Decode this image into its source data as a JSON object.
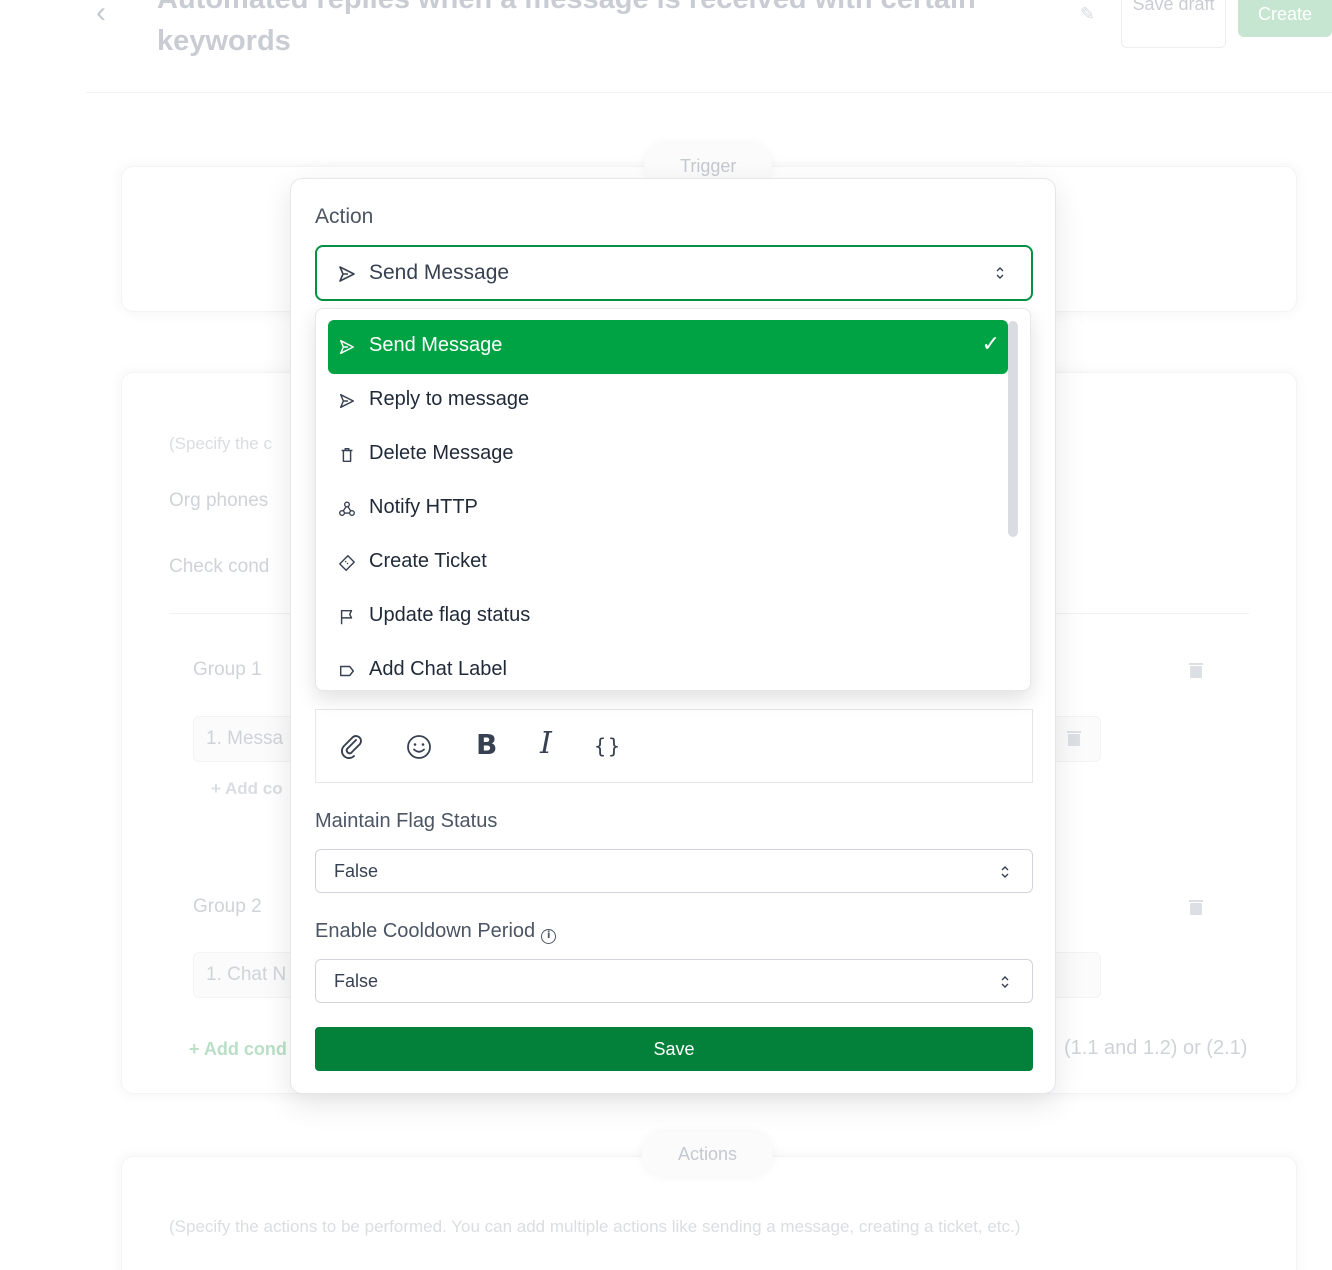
{
  "header": {
    "title": "Automated replies when a message is received with certain keywords",
    "save_draft_label": "Save draft",
    "create_label": "Create"
  },
  "background": {
    "trigger_label": "Trigger",
    "conditions_hint": "(Specify the c",
    "org_phones_label": "Org phones",
    "check_conditions_label": "Check cond",
    "group1_label": "Group 1",
    "group1_condition": "1. Messa",
    "add_condition_inner": "+ Add co",
    "group2_label": "Group 2",
    "group2_condition": "1. Chat N",
    "add_condition_outer": "+ Add cond",
    "logic_summary": "(1.1 and 1.2) or (2.1)",
    "actions_label": "Actions",
    "actions_hint": "(Specify the actions to be performed. You can add multiple actions like sending a message, creating a ticket, etc.)"
  },
  "modal": {
    "action_label": "Action",
    "action_selected": "Send Message",
    "dropdown_options": [
      {
        "label": "Send Message",
        "icon": "send-icon",
        "selected": true
      },
      {
        "label": "Reply to message",
        "icon": "send-icon",
        "selected": false
      },
      {
        "label": "Delete Message",
        "icon": "trash-icon",
        "selected": false
      },
      {
        "label": "Notify HTTP",
        "icon": "webhook-icon",
        "selected": false
      },
      {
        "label": "Create Ticket",
        "icon": "ticket-icon",
        "selected": false
      },
      {
        "label": "Update flag status",
        "icon": "flag-icon",
        "selected": false
      },
      {
        "label": "Add Chat Label",
        "icon": "label-icon",
        "selected": false
      }
    ],
    "maintain_flag_label": "Maintain Flag Status",
    "maintain_flag_value": "False",
    "cooldown_label": "Enable Cooldown Period",
    "cooldown_value": "False",
    "save_label": "Save"
  },
  "colors": {
    "primary_green": "#00a344",
    "save_green": "#03813a",
    "border_green": "#059142"
  }
}
